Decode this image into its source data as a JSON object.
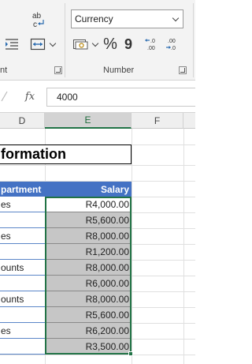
{
  "ribbon": {
    "alignment_group_label": "nt",
    "number_group_label": "Number",
    "number_format": "Currency",
    "buttons": {
      "wrap_text": "ab c",
      "merge_center": "merge",
      "accounting": "accounting",
      "percent": "%",
      "comma": "9",
      "increase_decimal": ".0 .00",
      "decrease_decimal": ".00 .0"
    }
  },
  "formula_bar": {
    "fx_label": "fx",
    "value": "4000"
  },
  "columns": [
    {
      "letter": "D"
    },
    {
      "letter": "E"
    },
    {
      "letter": "F"
    }
  ],
  "sheet": {
    "title": "formation",
    "header": {
      "department": "partment",
      "salary": "Salary"
    },
    "rows": [
      {
        "department": "es",
        "salary": "R4,000.00"
      },
      {
        "department": "",
        "salary": "R5,600.00"
      },
      {
        "department": "es",
        "salary": "R8,000.00"
      },
      {
        "department": "",
        "salary": "R1,200.00"
      },
      {
        "department": "ounts",
        "salary": "R8,000.00"
      },
      {
        "department": "",
        "salary": "R6,000.00"
      },
      {
        "department": "ounts",
        "salary": "R8,000.00"
      },
      {
        "department": "",
        "salary": "R5,600.00"
      },
      {
        "department": "es",
        "salary": "R6,200.00"
      },
      {
        "department": "",
        "salary": "R3,500.00"
      }
    ]
  },
  "colors": {
    "header_fill": "#4472c4",
    "selection": "#217346",
    "selected_fill": "#c6c6c6"
  }
}
